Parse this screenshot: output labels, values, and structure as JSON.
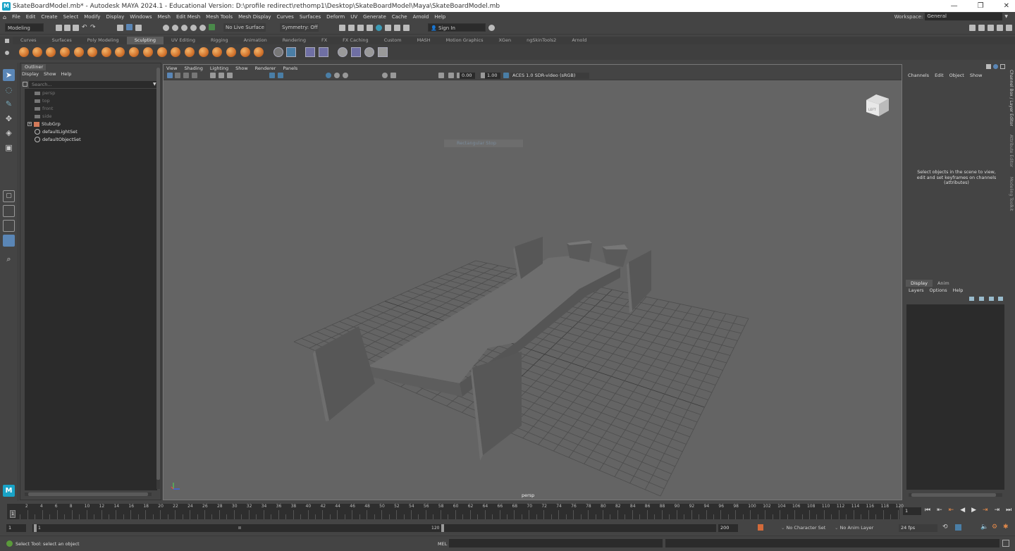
{
  "window": {
    "app_icon": "M",
    "title": "SkateBoardModel.mb* - Autodesk MAYA 2024.1 - Educational Version: D:\\profile redirect\\rethomp1\\Desktop\\SkateBoardModel\\Maya\\SkateBoardModel.mb",
    "controls": [
      "—",
      "❐",
      "✕"
    ]
  },
  "menu": [
    "File",
    "Edit",
    "Create",
    "Select",
    "Modify",
    "Display",
    "Windows",
    "Mesh",
    "Edit Mesh",
    "Mesh Tools",
    "Mesh Display",
    "Curves",
    "Surfaces",
    "Deform",
    "UV",
    "Generate",
    "Cache",
    "Arnold",
    "Help"
  ],
  "workspace": {
    "label": "Workspace:",
    "value": "General"
  },
  "status": {
    "mode": "Modeling",
    "live_surface": "No Live Surface",
    "symmetry": "Symmetry: Off",
    "sign_in": "Sign In"
  },
  "shelf": {
    "tabs": [
      "Curves",
      "Surfaces",
      "Poly Modeling",
      "Sculpting",
      "UV Editing",
      "Rigging",
      "Animation",
      "Rendering",
      "FX",
      "FX Caching",
      "Custom",
      "MASH",
      "Motion Graphics",
      "XGen",
      "ngSkinTools2",
      "Arnold"
    ],
    "active_tab": "Sculpting"
  },
  "outliner": {
    "tab": "Outliner",
    "menus": [
      "Display",
      "Show",
      "Help"
    ],
    "search_placeholder": "Search...",
    "items": [
      {
        "label": "persp",
        "dim": true,
        "icon": "camera-icon"
      },
      {
        "label": "top",
        "dim": true,
        "icon": "camera-icon"
      },
      {
        "label": "front",
        "dim": true,
        "icon": "camera-icon"
      },
      {
        "label": "side",
        "dim": true,
        "icon": "camera-icon"
      },
      {
        "label": "StubGrp",
        "dim": false,
        "icon": "group-icon"
      },
      {
        "label": "defaultLightSet",
        "dim": false,
        "icon": "set-icon"
      },
      {
        "label": "defaultObjectSet",
        "dim": false,
        "icon": "set-icon"
      }
    ]
  },
  "viewport": {
    "menus": [
      "View",
      "Shading",
      "Lighting",
      "Show",
      "Renderer",
      "Panels"
    ],
    "exposure": "0.00",
    "gamma": "1.00",
    "color_space": "ACES 1.0 SDR-video (sRGB)",
    "hud": "Rectangular Stop",
    "camera": "persp",
    "viewcube": "LEFT"
  },
  "channel_box": {
    "menus": [
      "Channels",
      "Edit",
      "Object",
      "Show"
    ],
    "message": "Select objects in the scene to view, edit and set keyframes on channels (attributes)"
  },
  "layer_editor": {
    "tabs": [
      "Display",
      "Anim"
    ],
    "menus": [
      "Layers",
      "Options",
      "Help"
    ]
  },
  "side_tabs": [
    "Channel Box / Layer Editor",
    "Attribute Editor",
    "Modeling Toolkit"
  ],
  "timeline": {
    "ticks": [
      2,
      4,
      6,
      8,
      10,
      12,
      14,
      16,
      18,
      20,
      22,
      24,
      26,
      28,
      30,
      32,
      34,
      36,
      38,
      40,
      42,
      44,
      46,
      48,
      50,
      52,
      54,
      56,
      58,
      60,
      62,
      64,
      66,
      68,
      70,
      72,
      74,
      76,
      78,
      80,
      82,
      84,
      86,
      88,
      90,
      92,
      94,
      96,
      98,
      100,
      102,
      104,
      106,
      108,
      110,
      112,
      114,
      116,
      118,
      120
    ],
    "current_frame_marker": "1",
    "current_frame": "1"
  },
  "range": {
    "start": "1",
    "inner_start": "1",
    "inner_end": "120",
    "end": "200",
    "character_set": "No Character Set",
    "anim_layer": "No Anim Layer",
    "fps": "24 fps"
  },
  "command": {
    "help": "Select Tool: select an object",
    "lang": "MEL"
  }
}
